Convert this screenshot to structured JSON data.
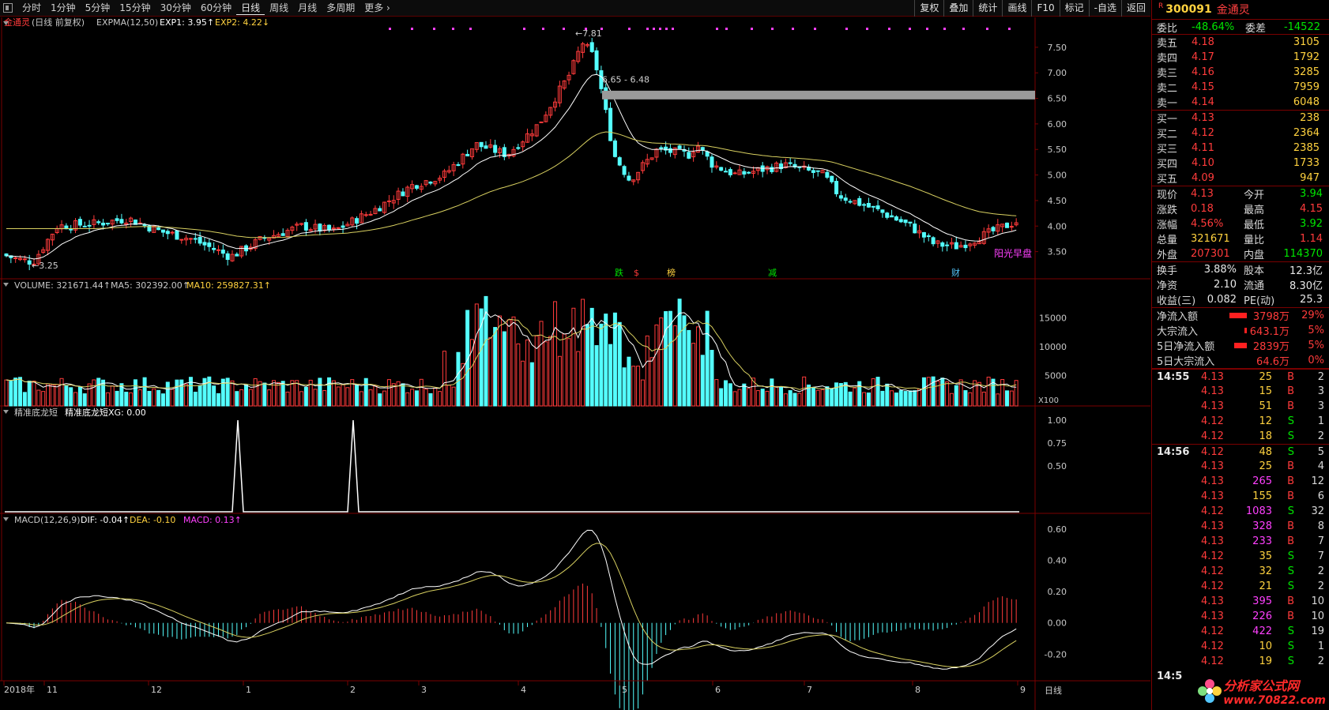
{
  "toolbar": {
    "periods": [
      "分时",
      "1分钟",
      "5分钟",
      "15分钟",
      "30分钟",
      "60分钟",
      "日线",
      "周线",
      "月线",
      "多周期",
      "更多"
    ],
    "active_period": "日线",
    "right_buttons": [
      "复权",
      "叠加",
      "统计",
      "画线",
      "F10",
      "标记",
      "-自选",
      "返回"
    ]
  },
  "main_chart": {
    "title": "金通灵",
    "subtitle": "(日线 前复权)",
    "indicator": "EXPMA(12,50)",
    "exp1": "EXP1: 3.95",
    "exp2": "EXP2: 4.22",
    "high_label": "7.81",
    "low_label": "3.25",
    "gap_label": "6.65 - 6.48",
    "y_ticks": [
      "7.50",
      "7.00",
      "6.50",
      "6.00",
      "5.50",
      "5.00",
      "4.50",
      "4.00",
      "3.50"
    ],
    "markers": [
      "跌",
      "$",
      "榜",
      "减",
      "财"
    ],
    "note": "阳光早盘"
  },
  "volume_chart": {
    "title": "VOLUME: 321671.44",
    "ma5": "MA5: 302392.00",
    "ma10": "MA10: 259827.31",
    "y_ticks": [
      "15000",
      "10000",
      "5000"
    ],
    "unit": "X100"
  },
  "signal_chart": {
    "title": "精准底龙短",
    "value": "精准底龙短XG: 0.00",
    "y_ticks": [
      "1.00",
      "0.75",
      "0.50"
    ]
  },
  "macd_chart": {
    "title": "MACD(12,26,9)",
    "dif": "DIF: -0.04",
    "dea": "DEA: -0.10",
    "macd": "MACD: 0.13",
    "y_ticks": [
      "0.60",
      "0.40",
      "0.20",
      "0.00",
      "-0.20"
    ]
  },
  "x_axis": {
    "labels": [
      "2018年",
      "11",
      "12",
      "1",
      "2",
      "3",
      "4",
      "5",
      "6",
      "7",
      "8",
      "9"
    ],
    "period_label": "日线"
  },
  "chart_data": {
    "type": "candlestick",
    "title": "金通灵(日线 前复权)",
    "price_range": [
      3.2,
      7.9
    ],
    "price_key_points": [
      {
        "label": "2018年11月 start",
        "close": 3.45
      },
      {
        "label": "low",
        "value": 3.25
      },
      {
        "label": "2019-03 rally",
        "close": 5.8
      },
      {
        "label": "high (Apr 2019)",
        "value": 7.81
      },
      {
        "label": "gap",
        "from": 6.48,
        "to": 6.65
      },
      {
        "label": "2019-06",
        "close": 5.5
      },
      {
        "label": "2019-08",
        "close": 3.6
      },
      {
        "label": "last close",
        "value": 4.13
      }
    ],
    "exp1_last": 3.95,
    "exp2_last": 4.22,
    "volume_last": 321671.44,
    "volume_range": [
      0,
      19000
    ],
    "signal_spikes": 2,
    "macd": {
      "dif": -0.04,
      "dea": -0.1,
      "macd": 0.13,
      "range": [
        -0.35,
        0.65
      ]
    }
  },
  "quote": {
    "flag": "R",
    "code": "300091",
    "name": "金通灵",
    "weibi_label": "委比",
    "weibi": "-48.64%",
    "weicha_label": "委差",
    "weicha": "-14522",
    "sell": [
      {
        "label": "卖五",
        "price": "4.18",
        "vol": "3105"
      },
      {
        "label": "卖四",
        "price": "4.17",
        "vol": "1792"
      },
      {
        "label": "卖三",
        "price": "4.16",
        "vol": "3285"
      },
      {
        "label": "卖二",
        "price": "4.15",
        "vol": "7959"
      },
      {
        "label": "卖一",
        "price": "4.14",
        "vol": "6048"
      }
    ],
    "buy": [
      {
        "label": "买一",
        "price": "4.13",
        "vol": "238"
      },
      {
        "label": "买二",
        "price": "4.12",
        "vol": "2364"
      },
      {
        "label": "买三",
        "price": "4.11",
        "vol": "2385"
      },
      {
        "label": "买四",
        "price": "4.10",
        "vol": "1733"
      },
      {
        "label": "买五",
        "price": "4.09",
        "vol": "947"
      }
    ],
    "stats": [
      {
        "l1": "现价",
        "v1": "4.13",
        "c1": "red",
        "l2": "今开",
        "v2": "3.94",
        "c2": "grn"
      },
      {
        "l1": "涨跌",
        "v1": "0.18",
        "c1": "red",
        "l2": "最高",
        "v2": "4.15",
        "c2": "red"
      },
      {
        "l1": "涨幅",
        "v1": "4.56%",
        "c1": "red",
        "l2": "最低",
        "v2": "3.92",
        "c2": "grn"
      },
      {
        "l1": "总量",
        "v1": "321671",
        "c1": "yel",
        "l2": "量比",
        "v2": "1.14",
        "c2": "red"
      },
      {
        "l1": "外盘",
        "v1": "207301",
        "c1": "red",
        "l2": "内盘",
        "v2": "114370",
        "c2": "grn"
      }
    ],
    "stats2": [
      {
        "l1": "换手",
        "v1": "3.88%",
        "l2": "股本",
        "v2": "12.3亿"
      },
      {
        "l1": "净资",
        "v1": "2.10",
        "l2": "流通",
        "v2": "8.30亿"
      },
      {
        "l1": "收益(三)",
        "v1": "0.082",
        "l2": "PE(动)",
        "v2": "25.3"
      }
    ],
    "flows": [
      {
        "label": "净流入额",
        "value": "3798万",
        "pct": "29%",
        "bar": 22
      },
      {
        "label": "大宗流入",
        "value": "643.1万",
        "pct": "5%",
        "bar": 3
      },
      {
        "label": "5日净流入额",
        "value": "2839万",
        "pct": "5%",
        "bar": 16
      },
      {
        "label": "5日大宗流入",
        "value": "64.6万",
        "pct": "0%",
        "bar": 0
      }
    ],
    "ticks": [
      {
        "time": "14:55",
        "price": "4.13",
        "vol": "25",
        "bs": "B",
        "n": "2",
        "pc": "red",
        "vc": "yel"
      },
      {
        "time": "",
        "price": "4.13",
        "vol": "15",
        "bs": "B",
        "n": "3",
        "pc": "red",
        "vc": "yel"
      },
      {
        "time": "",
        "price": "4.13",
        "vol": "51",
        "bs": "B",
        "n": "3",
        "pc": "red",
        "vc": "yel"
      },
      {
        "time": "",
        "price": "4.12",
        "vol": "12",
        "bs": "S",
        "n": "1",
        "pc": "red",
        "vc": "yel"
      },
      {
        "time": "",
        "price": "4.12",
        "vol": "18",
        "bs": "S",
        "n": "2",
        "pc": "red",
        "vc": "yel"
      },
      {
        "time": "14:56",
        "price": "4.12",
        "vol": "48",
        "bs": "S",
        "n": "5",
        "pc": "red",
        "vc": "yel"
      },
      {
        "time": "",
        "price": "4.13",
        "vol": "25",
        "bs": "B",
        "n": "4",
        "pc": "red",
        "vc": "yel"
      },
      {
        "time": "",
        "price": "4.13",
        "vol": "265",
        "bs": "B",
        "n": "12",
        "pc": "red",
        "vc": "mag"
      },
      {
        "time": "",
        "price": "4.13",
        "vol": "155",
        "bs": "B",
        "n": "6",
        "pc": "red",
        "vc": "yel"
      },
      {
        "time": "",
        "price": "4.12",
        "vol": "1083",
        "bs": "S",
        "n": "32",
        "pc": "red",
        "vc": "mag"
      },
      {
        "time": "",
        "price": "4.13",
        "vol": "328",
        "bs": "B",
        "n": "8",
        "pc": "red",
        "vc": "mag"
      },
      {
        "time": "",
        "price": "4.13",
        "vol": "233",
        "bs": "B",
        "n": "7",
        "pc": "red",
        "vc": "mag"
      },
      {
        "time": "",
        "price": "4.12",
        "vol": "35",
        "bs": "S",
        "n": "7",
        "pc": "red",
        "vc": "yel"
      },
      {
        "time": "",
        "price": "4.12",
        "vol": "32",
        "bs": "S",
        "n": "2",
        "pc": "red",
        "vc": "yel"
      },
      {
        "time": "",
        "price": "4.12",
        "vol": "21",
        "bs": "S",
        "n": "2",
        "pc": "red",
        "vc": "yel"
      },
      {
        "time": "",
        "price": "4.13",
        "vol": "395",
        "bs": "B",
        "n": "10",
        "pc": "red",
        "vc": "mag"
      },
      {
        "time": "",
        "price": "4.13",
        "vol": "226",
        "bs": "B",
        "n": "10",
        "pc": "red",
        "vc": "mag"
      },
      {
        "time": "",
        "price": "4.12",
        "vol": "422",
        "bs": "S",
        "n": "19",
        "pc": "red",
        "vc": "mag"
      },
      {
        "time": "",
        "price": "4.12",
        "vol": "10",
        "bs": "S",
        "n": "1",
        "pc": "red",
        "vc": "yel"
      },
      {
        "time": "",
        "price": "4.12",
        "vol": "19",
        "bs": "S",
        "n": "2",
        "pc": "red",
        "vc": "yel"
      }
    ],
    "time_cut": "14:5",
    "watermark_top": "分析家公式网",
    "watermark_bottom": "www.70822.com"
  },
  "colors": {
    "up": "#ff3b3b",
    "down": "#54ffff",
    "exp1": "#ffffff",
    "exp2": "#d8d060",
    "bg": "#000000",
    "grid": "#5a0000"
  }
}
